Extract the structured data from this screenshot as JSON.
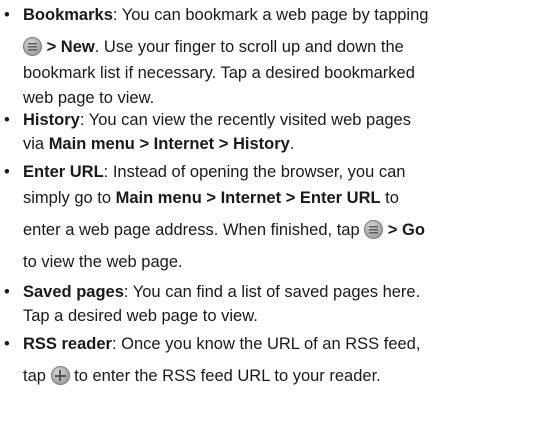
{
  "bullet_char": "•",
  "items": [
    {
      "term": "Bookmarks",
      "l1_rest": ": You can bookmark a web page by tapping",
      "l2_rest": " > New",
      "l2_after": ". Use your finger to scroll up and down the",
      "l3": "bookmark list if necessary. Tap a desired bookmarked",
      "l4": "web page to view.",
      "icon": "menu-icon"
    },
    {
      "term": "History",
      "l1_rest": ": You can view the recently visited web pages",
      "l2_pre": "via ",
      "l2_bold": "Main menu > Internet > History",
      "l2_post": "."
    },
    {
      "term": "Enter URL",
      "l1_rest": ": Instead of opening the browser, you can",
      "l2_pre": "simply go to ",
      "l2_bold": "Main menu > Internet > Enter URL",
      "l2_post": " to",
      "l3_pre": "enter a web page address. When finished, tap ",
      "l3_bold": " > Go",
      "l4": "to view the web page.",
      "icon": "menu-icon"
    },
    {
      "term": "Saved pages",
      "l1_rest": ": You can find a list of saved pages here.",
      "l2": "Tap a desired web page to view."
    },
    {
      "term": "RSS reader",
      "l1_rest": ": Once you know the URL of an RSS feed,",
      "l2_pre": "tap ",
      "l2_post": " to enter the RSS feed URL to your reader.",
      "icon": "plus-icon"
    }
  ]
}
